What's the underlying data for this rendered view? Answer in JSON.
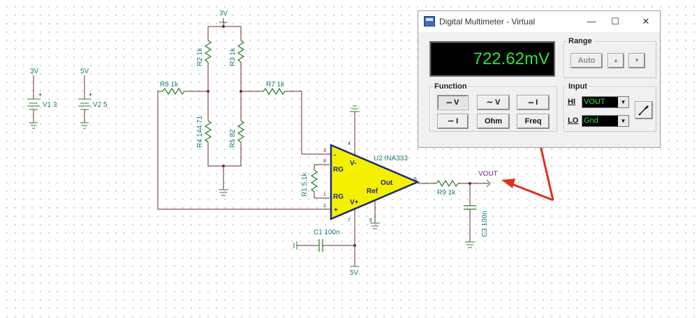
{
  "window": {
    "title": "Digital Multimeter - Virtual",
    "minimize": "—",
    "maximize": "☐",
    "close": "✕"
  },
  "display": {
    "reading": "722.62mV",
    "color": "#2ee53a"
  },
  "range": {
    "title": "Range",
    "auto": "Auto",
    "up": "▲",
    "down": "▼"
  },
  "function": {
    "title": "Function",
    "buttons": [
      "V",
      "V",
      "I",
      "I",
      "Ohm",
      "Freq"
    ],
    "selected": "DC V"
  },
  "input": {
    "title": "Input",
    "hi_label": "HI",
    "hi_value": "VOUT",
    "lo_label": "LO",
    "lo_value": "Gnd",
    "probe": "probe-icon"
  },
  "schematic": {
    "top_supply": "3V",
    "bottom_supply": "5V",
    "v1_value": "3V",
    "v1": "V1 3",
    "v2_value": "5V",
    "v2": "V2 5",
    "r1": "R1 5.1k",
    "r2": "R2 1k",
    "r3": "R3 1k",
    "r4": "R4 144.71",
    "r5": "R5 82",
    "r7": "R7 1k",
    "r8": "R8 1k",
    "r9": "R9 1k",
    "c1": "C1 100n",
    "c3": "C3 100n",
    "u2": "U2 INA333",
    "vout": "VOUT",
    "op_pins": {
      "minus": "-",
      "plus": "+",
      "rg_top": "RG",
      "rg_bot": "RG",
      "vminus": "V-",
      "vplus": "V+",
      "out": "Out",
      "ref": "Ref"
    },
    "pin_numbers": [
      "3",
      "8",
      "1",
      "2",
      "4",
      "7",
      "5",
      "6"
    ]
  },
  "colors": {
    "wire": "#6b2a2a",
    "resistor": "#1f7a1f",
    "opamp_fill": "#f5f000",
    "opamp_border": "#1a2a7a",
    "arrow": "#e0301e"
  }
}
